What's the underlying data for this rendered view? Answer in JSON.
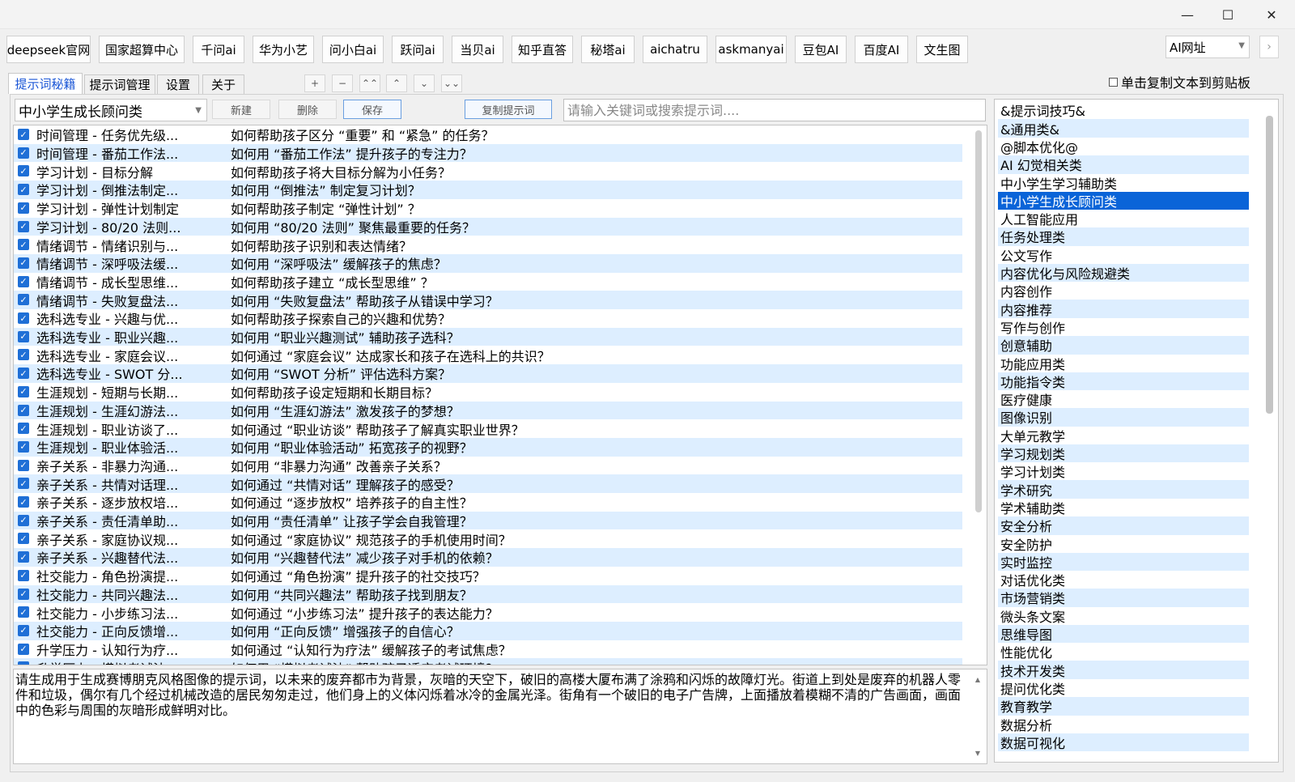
{
  "window": {
    "minimize_label": "—",
    "maximize_label": "☐",
    "close_label": "✕"
  },
  "toolbar": {
    "buttons": [
      "deepseek官网",
      "国家超算中心",
      "千问ai",
      "华为小艺",
      "问小白ai",
      "跃问ai",
      "当贝ai",
      "知乎直答",
      "秘塔ai",
      "aichatru",
      "askmanyai",
      "豆包AI",
      "百度AI",
      "文生图"
    ],
    "ai_select_value": "AI网址",
    "ai_go_label": "›"
  },
  "tabs": [
    "提示词秘籍",
    "提示词管理",
    "设置",
    "关于"
  ],
  "move_buttons": [
    "+",
    "−",
    "⌃⌃",
    "⌃",
    "⌄",
    "⌄⌄"
  ],
  "copy_to_clipboard_label": "单击复制文本到剪贴板",
  "controls": {
    "category_value": "中小学生成长顾问类",
    "new_label": "新建",
    "delete_label": "删除",
    "save_label": "保存",
    "copy_prompt_label": "复制提示词",
    "search_placeholder": "请输入关键词或搜索提示词...."
  },
  "prompts": [
    {
      "title": "时间管理 - 任务优先级...",
      "question": "如何帮助孩子区分 “重要” 和 “紧急” 的任务？"
    },
    {
      "title": "时间管理 - 番茄工作法...",
      "question": "如何用 “番茄工作法” 提升孩子的专注力？"
    },
    {
      "title": "学习计划 - 目标分解",
      "question": "如何帮助孩子将大目标分解为小任务？"
    },
    {
      "title": "学习计划 - 倒推法制定...",
      "question": "如何用 “倒推法” 制定复习计划？"
    },
    {
      "title": "学习计划 - 弹性计划制定",
      "question": "如何帮助孩子制定 “弹性计划” ？"
    },
    {
      "title": "学习计划 - 80/20 法则...",
      "question": "如何用 “80/20 法则” 聚焦最重要的任务？"
    },
    {
      "title": "情绪调节 - 情绪识别与...",
      "question": "如何帮助孩子识别和表达情绪？"
    },
    {
      "title": "情绪调节 - 深呼吸法缓...",
      "question": "如何用 “深呼吸法” 缓解孩子的焦虑？"
    },
    {
      "title": "情绪调节 - 成长型思维...",
      "question": "如何帮助孩子建立 “成长型思维” ？"
    },
    {
      "title": "情绪调节 - 失败复盘法...",
      "question": "如何用 “失败复盘法” 帮助孩子从错误中学习？"
    },
    {
      "title": "选科选专业 - 兴趣与优...",
      "question": "如何帮助孩子探索自己的兴趣和优势？"
    },
    {
      "title": "选科选专业 - 职业兴趣...",
      "question": "如何用 “职业兴趣测试” 辅助孩子选科？"
    },
    {
      "title": "选科选专业 - 家庭会议...",
      "question": "如何通过 “家庭会议” 达成家长和孩子在选科上的共识？"
    },
    {
      "title": "选科选专业 - SWOT 分...",
      "question": "如何用 “SWOT 分析” 评估选科方案？"
    },
    {
      "title": "生涯规划 - 短期与长期...",
      "question": "如何帮助孩子设定短期和长期目标？"
    },
    {
      "title": "生涯规划 - 生涯幻游法...",
      "question": "如何用 “生涯幻游法” 激发孩子的梦想？"
    },
    {
      "title": "生涯规划 - 职业访谈了...",
      "question": "如何通过 “职业访谈” 帮助孩子了解真实职业世界？"
    },
    {
      "title": "生涯规划 - 职业体验活...",
      "question": "如何用 “职业体验活动” 拓宽孩子的视野？"
    },
    {
      "title": "亲子关系 - 非暴力沟通...",
      "question": "如何用 “非暴力沟通” 改善亲子关系？"
    },
    {
      "title": "亲子关系 - 共情对话理...",
      "question": "如何通过 “共情对话” 理解孩子的感受？"
    },
    {
      "title": "亲子关系 - 逐步放权培...",
      "question": "如何通过 “逐步放权” 培养孩子的自主性？"
    },
    {
      "title": "亲子关系 - 责任清单助...",
      "question": "如何用 “责任清单” 让孩子学会自我管理？"
    },
    {
      "title": "亲子关系 - 家庭协议规...",
      "question": "如何通过 “家庭协议” 规范孩子的手机使用时间？"
    },
    {
      "title": "亲子关系 - 兴趣替代法...",
      "question": "如何用 “兴趣替代法” 减少孩子对手机的依赖？"
    },
    {
      "title": "社交能力 - 角色扮演提...",
      "question": "如何通过 “角色扮演” 提升孩子的社交技巧？"
    },
    {
      "title": "社交能力 - 共同兴趣法...",
      "question": "如何用 “共同兴趣法” 帮助孩子找到朋友？"
    },
    {
      "title": "社交能力 - 小步练习法...",
      "question": "如何通过 “小步练习法” 提升孩子的表达能力？"
    },
    {
      "title": "社交能力 - 正向反馈增...",
      "question": "如何用 “正向反馈” 增强孩子的自信心？"
    },
    {
      "title": "升学压力 - 认知行为疗...",
      "question": "如何通过 “认知行为疗法” 缓解孩子的考试焦虑？"
    },
    {
      "title": "升学压力 - 模拟考试法...",
      "question": "如何用 “模拟考试法” 帮助孩子适应考试环境？"
    }
  ],
  "editor_text": "请生成用于生成赛博朋克风格图像的提示词，以未来的废弃都市为背景，灰暗的天空下，破旧的高楼大厦布满了涂鸦和闪烁的故障灯光。街道上到处是废弃的机器人零件和垃圾，偶尔有几个经过机械改造的居民匆匆走过，他们身上的义体闪烁着冰冷的金属光泽。街角有一个破旧的电子广告牌，上面播放着模糊不清的广告画面，画面中的色彩与周围的灰暗形成鲜明对比。",
  "categories": [
    "&提示词技巧&",
    "&通用类&",
    "@脚本优化@",
    "AI 幻觉相关类",
    "中小学生学习辅助类",
    "中小学生成长顾问类",
    "人工智能应用",
    "任务处理类",
    "公文写作",
    "内容优化与风险规避类",
    "内容创作",
    "内容推荐",
    "写作与创作",
    "创意辅助",
    "功能应用类",
    "功能指令类",
    "医疗健康",
    "图像识别",
    "大单元教学",
    "学习规划类",
    "学习计划类",
    "学术研究",
    "学术辅助类",
    "安全分析",
    "安全防护",
    "实时监控",
    "对话优化类",
    "市场营销类",
    "微头条文案",
    "思维导图",
    "性能优化",
    "技术开发类",
    "提问优化类",
    "教育教学",
    "数据分析",
    "数据可视化"
  ],
  "selected_category_index": 5,
  "colors": {
    "row_shade": "#ddeeff",
    "selected": "#0a64d8",
    "active_tab_text": "#1a56d6",
    "checkbox": "#1f6fd6"
  }
}
